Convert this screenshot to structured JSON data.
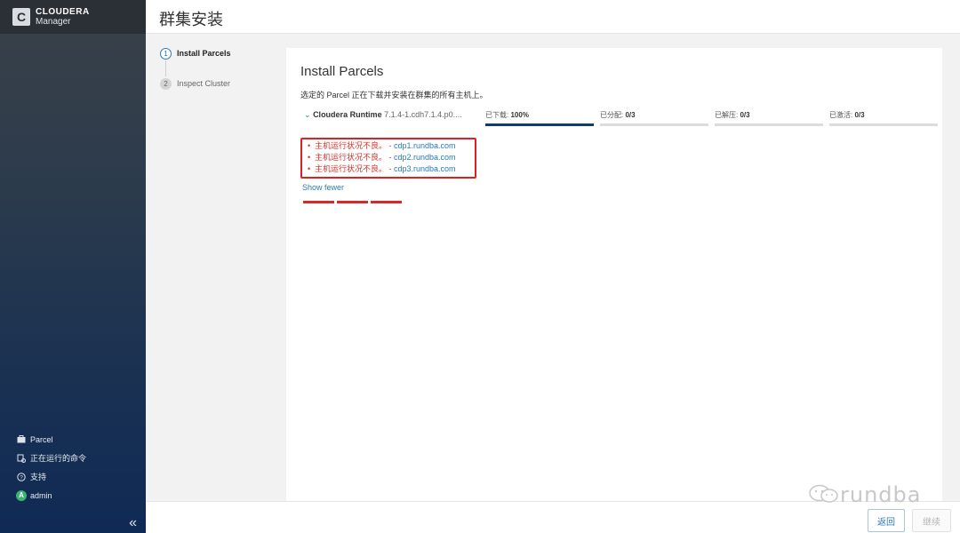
{
  "brand": {
    "name": "CLOUDERA",
    "product": "Manager",
    "logo_letter": "C"
  },
  "sidebar": {
    "items": [
      {
        "icon": "briefcase-icon",
        "label": "Parcel"
      },
      {
        "icon": "running-commands-icon",
        "label": "正在运行的命令"
      },
      {
        "icon": "help-icon",
        "label": "支持"
      },
      {
        "icon": "user-avatar",
        "label": "admin",
        "avatar_letter": "A"
      }
    ],
    "collapse_symbol": "«"
  },
  "header": {
    "title": "群集安装"
  },
  "steps": [
    {
      "num": "1",
      "label": "Install Parcels",
      "state": "active"
    },
    {
      "num": "2",
      "label": "Inspect Cluster",
      "state": "inactive"
    }
  ],
  "card": {
    "title": "Install Parcels",
    "description": "选定的 Parcel 正在下载并安装在群集的所有主机上。"
  },
  "parcel": {
    "toggle": "⌄",
    "name": "Cloudera Runtime",
    "version": "7.1.4-1.cdh7.1.4.p0....",
    "progress": [
      {
        "label": "已下载:",
        "value": "100%",
        "fraction": 1.0
      },
      {
        "label": "已分配:",
        "value": "0/3",
        "fraction": 0.0
      },
      {
        "label": "已解压:",
        "value": "0/3",
        "fraction": 0.0
      },
      {
        "label": "已激活:",
        "value": "0/3",
        "fraction": 0.0
      }
    ]
  },
  "errors": [
    {
      "message": "主机运行状况不良。",
      "sep": " - ",
      "host": "cdp1.rundba.com"
    },
    {
      "message": "主机运行状况不良。",
      "sep": " - ",
      "host": "cdp2.rundba.com"
    },
    {
      "message": "主机运行状况不良。",
      "sep": " - ",
      "host": "cdp3.rundba.com"
    }
  ],
  "show_fewer": "Show fewer",
  "watermark": "rundba",
  "footer": {
    "back_label": "返回",
    "next_label": "继续"
  },
  "colors": {
    "accent": "#2a7ab8",
    "error": "#d0312d",
    "progress_fill": "#103b78"
  }
}
